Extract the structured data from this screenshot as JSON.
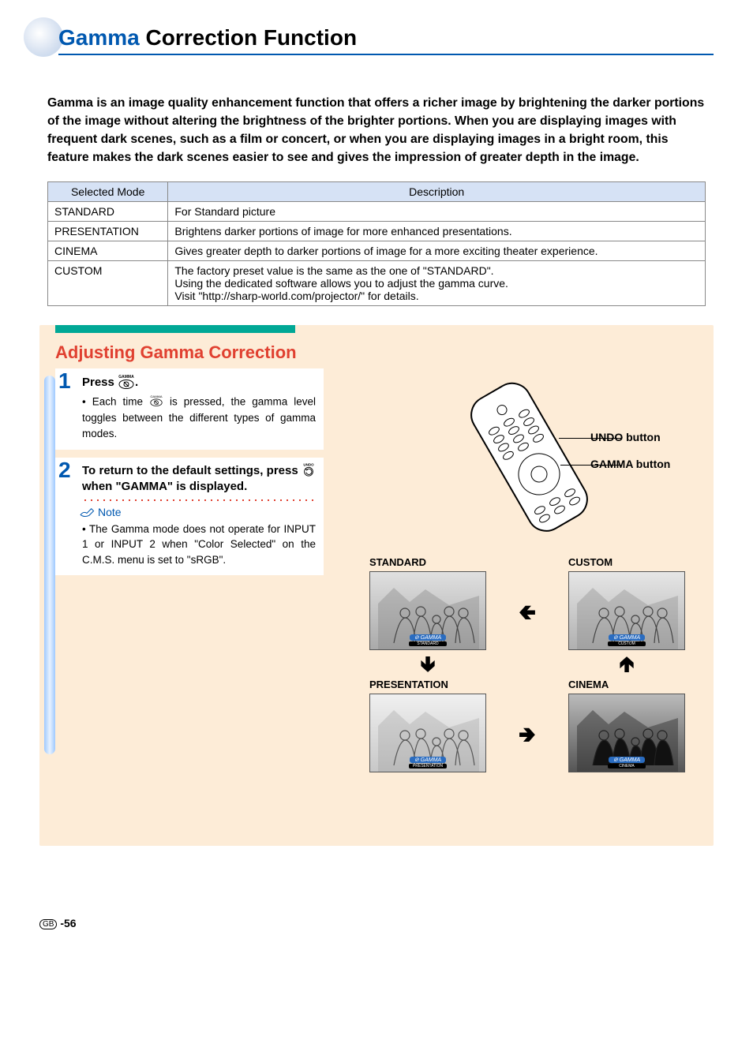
{
  "header": {
    "title_blue": "Gamma",
    "title_rest": " Correction Function"
  },
  "intro": "Gamma is an image quality enhancement function that offers a richer image by brightening the darker portions of the image without altering the brightness of the brighter portions. When you are displaying images with frequent dark scenes, such as a film or concert, or when you are displaying images in a bright room, this feature makes the dark scenes easier to see and gives the impression of greater depth in the image.",
  "table": {
    "head_mode": "Selected Mode",
    "head_desc": "Description",
    "rows": [
      {
        "mode": "STANDARD",
        "desc": "For Standard picture"
      },
      {
        "mode": "PRESENTATION",
        "desc": "Brightens darker portions of image for more enhanced presentations."
      },
      {
        "mode": "CINEMA",
        "desc": "Gives greater depth to darker portions of image for a more exciting theater experience."
      },
      {
        "mode": "CUSTOM",
        "desc": "The factory preset value is the same as the one of \"STANDARD\".\nUsing the dedicated software allows you to adjust the gamma curve.\nVisit \"http://sharp-world.com/projector/\" for details."
      }
    ]
  },
  "section_title": "Adjusting Gamma Correction",
  "steps": {
    "s1": {
      "num": "1",
      "head_a": "Press ",
      "head_b": ".",
      "body_a": "• Each time ",
      "body_b": " is pressed, the gamma level toggles between the different types of gamma modes.",
      "btn_label": "GAMMA"
    },
    "s2": {
      "num": "2",
      "head_a": "To return to the default settings, press ",
      "head_b": " when \"GAMMA\" is displayed.",
      "btn_label": "UNDO"
    },
    "note_label": "Note",
    "note_text": "• The Gamma mode does not operate for INPUT 1 or INPUT 2 when \"Color Selected\" on the C.M.S. menu is set to \"sRGB\"."
  },
  "callouts": {
    "undo": "UNDO button",
    "gamma": "GAMMA button"
  },
  "modes": {
    "standard": "STANDARD",
    "custom": "CUSTOM",
    "presentation": "PRESENTATION",
    "cinema": "CINEMA",
    "arrow_left": "🢀",
    "arrow_right": "🢂",
    "arrow_down": "🢃",
    "arrow_up": "🢁",
    "osd": "GAMMA"
  },
  "footer": {
    "region": "GB",
    "page": "-56"
  }
}
